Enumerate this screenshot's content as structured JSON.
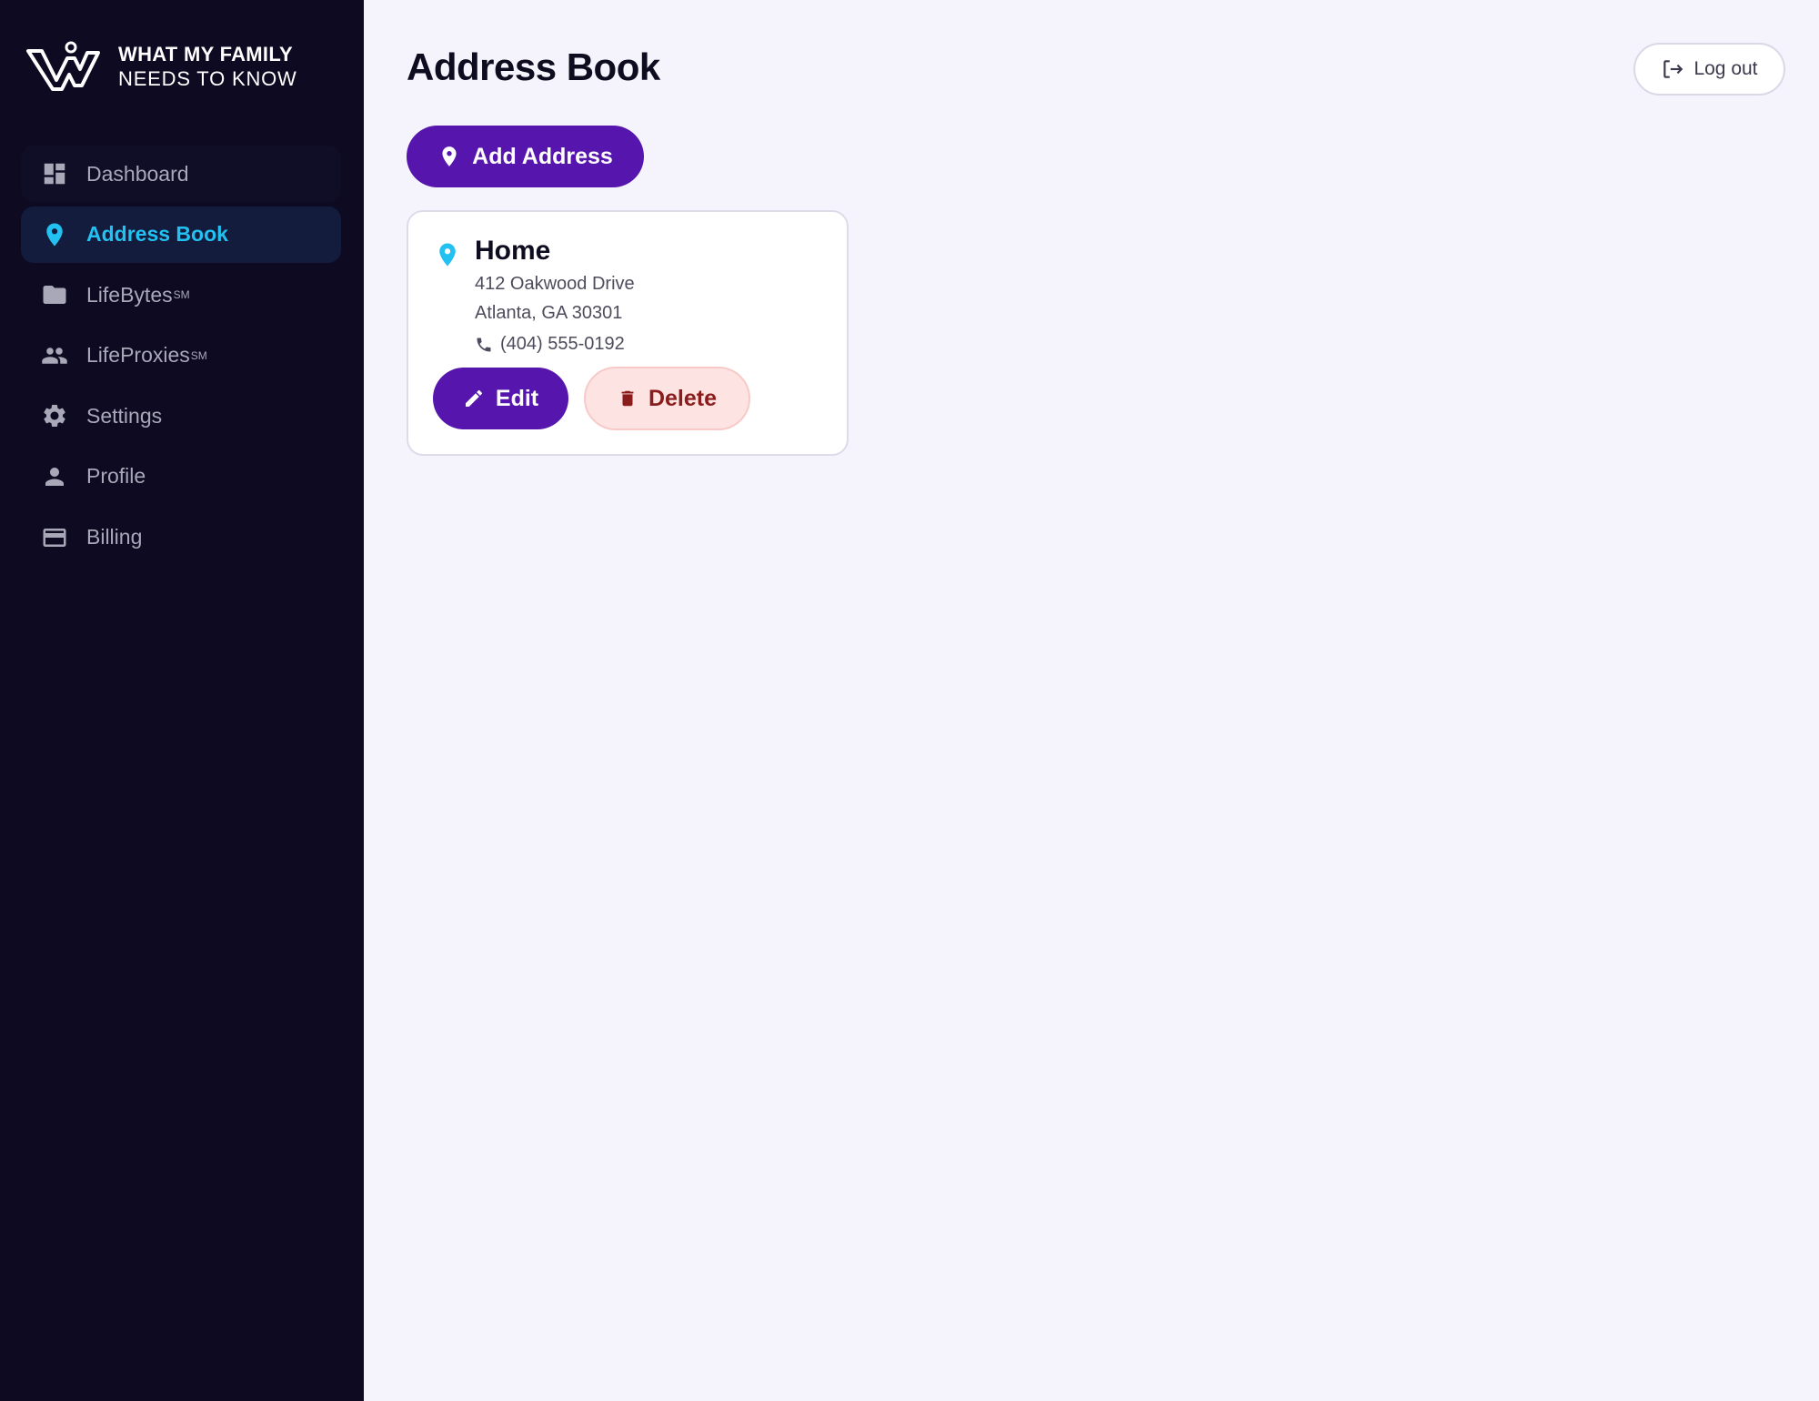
{
  "brand": {
    "line1": "WHAT MY FAMILY",
    "line2": "NEEDS TO KNOW",
    "logo_icon": "wmf-logo-icon"
  },
  "sidebar": {
    "items": [
      {
        "label": "Dashboard",
        "icon": "dashboard-icon",
        "active": false
      },
      {
        "label": "Address Book",
        "icon": "location-pin-icon",
        "active": true
      },
      {
        "label": "LifeBytes",
        "sup": "SM",
        "icon": "folder-icon",
        "active": false
      },
      {
        "label": "LifeProxies",
        "sup": "SM",
        "icon": "people-icon",
        "active": false
      },
      {
        "label": "Settings",
        "icon": "gear-icon",
        "active": false
      },
      {
        "label": "Profile",
        "icon": "person-icon",
        "active": false
      },
      {
        "label": "Billing",
        "icon": "credit-card-icon",
        "active": false
      }
    ]
  },
  "header": {
    "title": "Address Book",
    "logout_label": "Log out"
  },
  "actions": {
    "add_label": "Add Address"
  },
  "addresses": [
    {
      "name": "Home",
      "street": "412 Oakwood Drive",
      "city_line": "Atlanta, GA 30301",
      "phone": "(404) 555-0192",
      "edit_label": "Edit",
      "delete_label": "Delete"
    }
  ],
  "colors": {
    "sidebar_bg": "#0d0a22",
    "accent_purple": "#5615ad",
    "accent_cyan": "#22c1f2",
    "delete_bg": "#fde4e3",
    "delete_text": "#8a1c1c",
    "page_bg": "#f5f4fd"
  }
}
